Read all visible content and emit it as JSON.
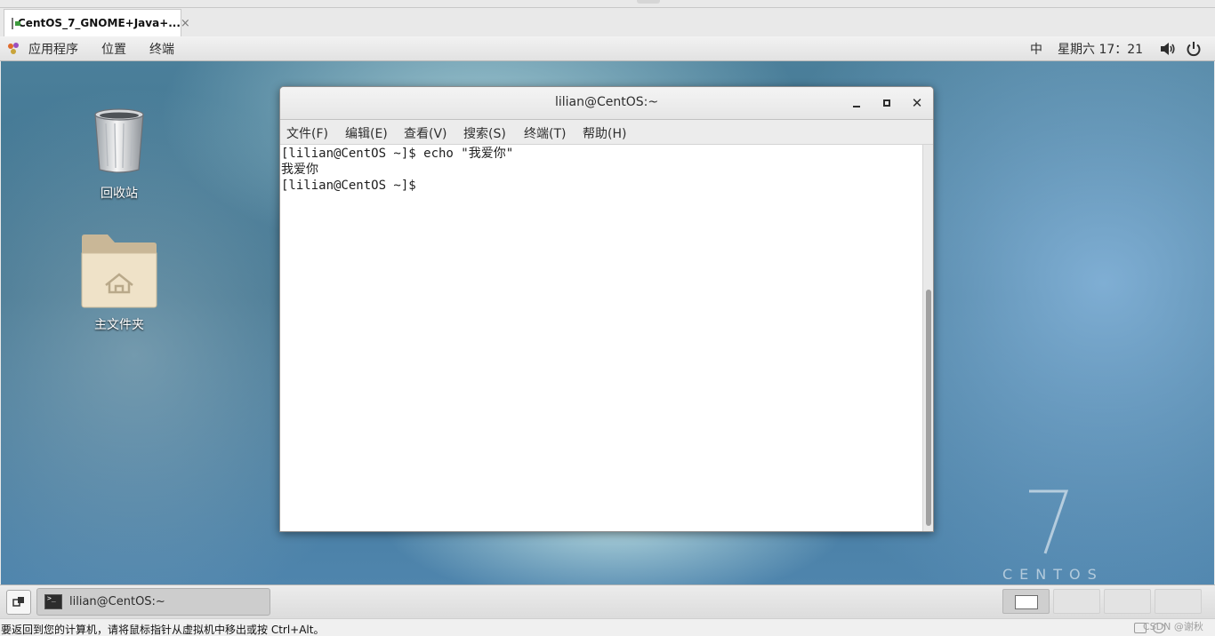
{
  "host": {
    "tab_title": "CentOS_7_GNOME+Java+...",
    "tab_close": "×",
    "status_text": "要返回到您的计算机，请将鼠标指针从虚拟机中移出或按 Ctrl+Alt。",
    "watermark": "CSDN @谢秋"
  },
  "topbar": {
    "apps_menu": "应用程序",
    "places_menu": "位置",
    "terminal_menu": "终端",
    "input_method": "中",
    "clock": "星期六 17：21"
  },
  "desktop": {
    "icons": [
      {
        "label": "回收站",
        "icon": "trash-icon"
      },
      {
        "label": "主文件夹",
        "icon": "home-folder-icon"
      }
    ],
    "brand_number": "7",
    "brand_word": "CENTOS"
  },
  "terminal": {
    "title": "lilian@CentOS:~",
    "menus": [
      "文件(F)",
      "编辑(E)",
      "查看(V)",
      "搜索(S)",
      "终端(T)",
      "帮助(H)"
    ],
    "lines": [
      "[lilian@CentOS ~]$ echo \"我爱你\"",
      "我爱你",
      "[lilian@CentOS ~]$ "
    ]
  },
  "taskbar": {
    "task_label": "lilian@CentOS:~"
  },
  "colors": {
    "desktop_base": "#3a6f8d",
    "panel_bg": "#e6e6e6",
    "terminal_bg": "#ffffff"
  }
}
